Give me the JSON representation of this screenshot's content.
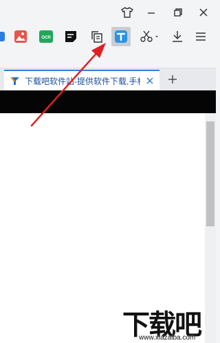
{
  "tab": {
    "title": "下载吧软件站-提供软件下载,手机"
  },
  "watermark": {
    "brand": "下载吧",
    "url": "www.xiazaiba.com"
  },
  "icons": {
    "window": [
      "skin-icon",
      "minimize-icon",
      "restore-icon",
      "close-icon"
    ],
    "toolbar": [
      "extension-partial-icon",
      "image-app-icon",
      "ocr-icon",
      "note-icon",
      "copy-icon",
      "text-tool-icon",
      "scissors-icon",
      "download-icon",
      "menu-icon"
    ]
  },
  "colors": {
    "tab_accent": "#2f7fe0",
    "arrow": "#e02020",
    "active_icon_bg": "#c9cdd3"
  }
}
